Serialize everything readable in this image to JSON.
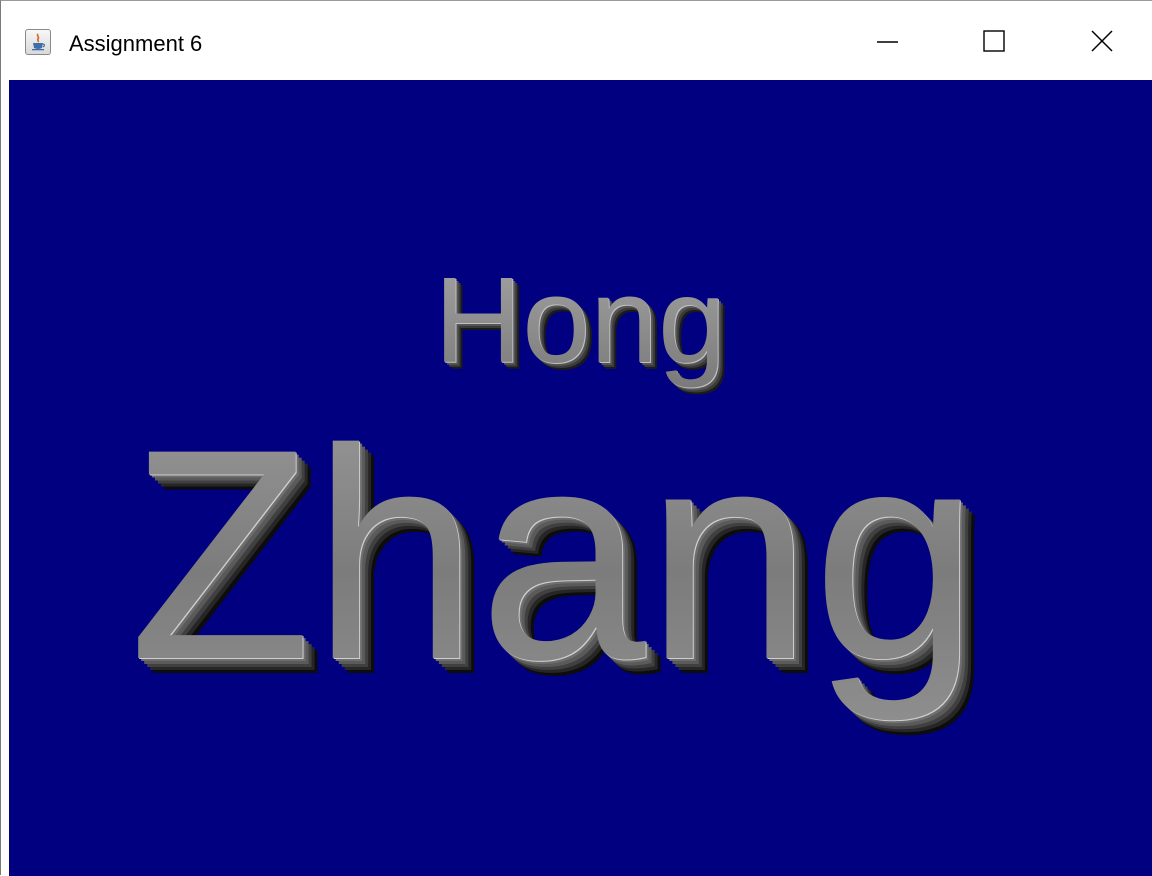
{
  "window": {
    "title": "Assignment 6",
    "app_icon": "java-cup-icon",
    "controls": {
      "minimize_icon": "minimize-icon",
      "maximize_icon": "maximize-icon",
      "close_icon": "close-icon"
    }
  },
  "canvas": {
    "background_color": "#000080",
    "text_color": "#8a8a8a",
    "first_name": "Hong",
    "last_name": "Zhang"
  }
}
